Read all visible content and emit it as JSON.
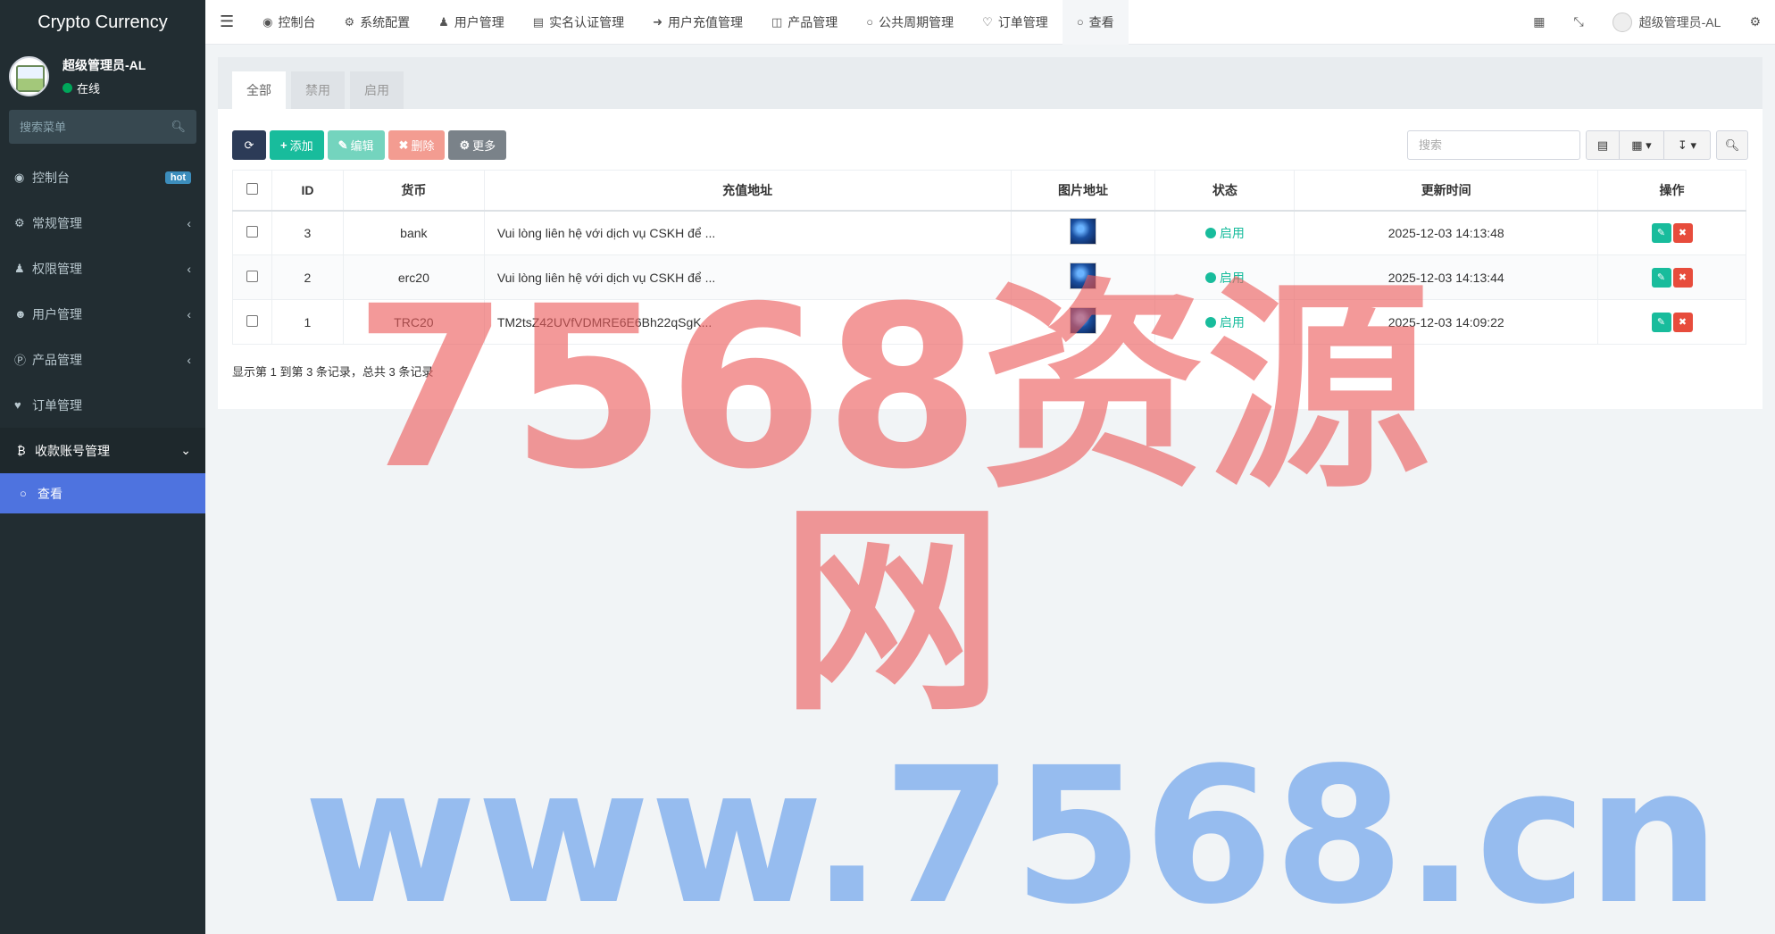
{
  "app": {
    "title": "Crypto Currency"
  },
  "user": {
    "name": "超级管理员-AL",
    "status": "在线"
  },
  "sidebar": {
    "search_placeholder": "搜索菜单",
    "items": [
      {
        "label": "控制台",
        "icon": "dashboard-icon",
        "badge": "hot"
      },
      {
        "label": "常规管理",
        "icon": "cogs-icon"
      },
      {
        "label": "权限管理",
        "icon": "group-icon"
      },
      {
        "label": "用户管理",
        "icon": "user-circle-icon"
      },
      {
        "label": "产品管理",
        "icon": "product-icon"
      },
      {
        "label": "订单管理",
        "icon": "heartbeat-icon"
      },
      {
        "label": "收款账号管理",
        "icon": "bitcoin-icon"
      }
    ],
    "sub_items": [
      {
        "label": "查看",
        "icon": "circle-icon"
      }
    ]
  },
  "topnav": {
    "items": [
      {
        "label": "控制台",
        "icon": "dashboard-icon"
      },
      {
        "label": "系统配置",
        "icon": "cog-icon"
      },
      {
        "label": "用户管理",
        "icon": "user-icon"
      },
      {
        "label": "实名认证管理",
        "icon": "id-card-icon"
      },
      {
        "label": "用户充值管理",
        "icon": "sign-in-icon"
      },
      {
        "label": "产品管理",
        "icon": "bag-icon"
      },
      {
        "label": "公共周期管理",
        "icon": "circle-icon"
      },
      {
        "label": "订单管理",
        "icon": "heartbeat-icon"
      },
      {
        "label": "查看",
        "icon": "circle-icon"
      }
    ],
    "right_user": "超级管理员-AL"
  },
  "tabs": [
    "全部",
    "禁用",
    "启用"
  ],
  "toolbar": {
    "add": "添加",
    "edit": "编辑",
    "delete": "删除",
    "more": "更多",
    "search_placeholder": "搜索"
  },
  "table": {
    "headers": [
      "ID",
      "货币",
      "充值地址",
      "图片地址",
      "状态",
      "更新时间",
      "操作"
    ],
    "rows": [
      {
        "id": "3",
        "currency": "bank",
        "address": "Vui lòng liên hệ với dịch vụ CSKH để ...",
        "status": "启用",
        "updated": "2025-12-03 14:13:48"
      },
      {
        "id": "2",
        "currency": "erc20",
        "address": "Vui lòng liên hệ với dịch vụ CSKH để ...",
        "status": "启用",
        "updated": "2025-12-03 14:13:44"
      },
      {
        "id": "1",
        "currency": "TRC20",
        "address": "TM2tsZ42UVfVDMRE6E6Bh22qSgK...",
        "status": "启用",
        "updated": "2025-12-03 14:09:22"
      }
    ]
  },
  "pager_text": "显示第 1 到第 3 条记录，总共 3 条记录",
  "watermark": {
    "line1": "7568资源网",
    "line2": "www.7568.cn"
  },
  "colors": {
    "sidebar": "#222d32",
    "accent": "#4e73df",
    "success": "#18bc9c",
    "danger": "#e74c3c"
  }
}
